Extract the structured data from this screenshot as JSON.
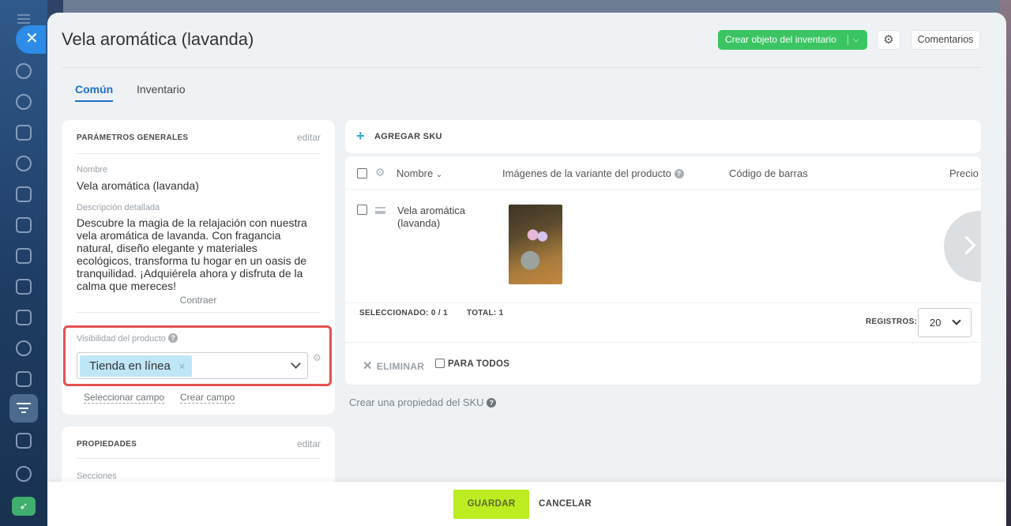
{
  "header": {
    "title": "Vela aromática (lavanda)",
    "create_button": "Crear objeto del inventario",
    "comments_button": "Comentarios"
  },
  "tabs": [
    {
      "label": "Común",
      "active": true
    },
    {
      "label": "Inventario",
      "active": false
    }
  ],
  "general": {
    "heading": "PARÁMETROS GENERALES",
    "edit": "editar",
    "name_label": "Nombre",
    "name_value": "Vela aromática (lavanda)",
    "desc_label": "Descripción detallada",
    "desc_value": "Descubre la magia de la relajación con nuestra vela aromática de lavanda. Con fragancia natural, diseño elegante y materiales ecológicos, transforma tu hogar en un oasis de tranquilidad. ¡Adquiérela ahora y disfruta de la calma que mereces!",
    "collapse": "Contraer",
    "visibility_label": "Visibilidad del producto",
    "visibility_value": "Tienda en línea",
    "select_field": "Seleccionar campo",
    "create_field": "Crear campo"
  },
  "properties": {
    "heading": "PROPIEDADES",
    "edit": "editar",
    "sections_label": "Secciones"
  },
  "sku": {
    "add_label": "AGREGAR SKU",
    "columns": [
      "Nombre",
      "Imágenes de la variante del producto",
      "Código de barras",
      "Precio"
    ],
    "rows": [
      {
        "name": "Vela aromática (lavanda)"
      }
    ],
    "selected_label": "SELECCIONADO:",
    "selected_value": "0 / 1",
    "total_label": "TOTAL:",
    "total_value": "1",
    "records_label": "REGISTROS:",
    "records_value": "20",
    "delete_label": "ELIMINAR",
    "for_all_label": "PARA TODOS",
    "create_property": "Crear una propiedad del SKU"
  },
  "footer": {
    "save": "GUARDAR",
    "cancel": "CANCELAR"
  },
  "colors": {
    "accent_green": "#3bc462",
    "save_lime": "#bbed21",
    "tab_blue": "#1f6fc8",
    "highlight_red": "#e3514e"
  }
}
